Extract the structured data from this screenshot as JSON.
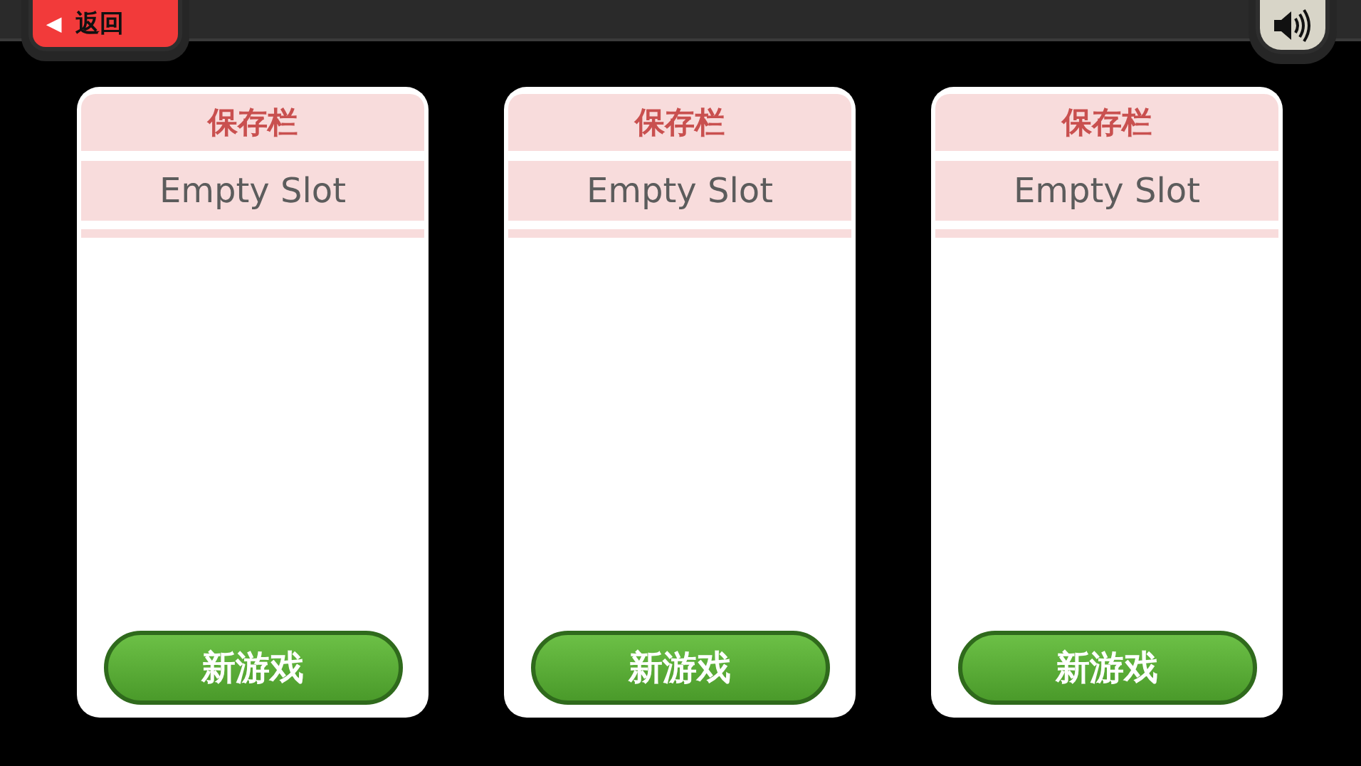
{
  "top_bar": {
    "back_button": {
      "arrow": "◀",
      "label": "返回"
    }
  },
  "save_slots": [
    {
      "title": "保存栏",
      "status": "Empty Slot",
      "button": "新游戏"
    },
    {
      "title": "保存栏",
      "status": "Empty Slot",
      "button": "新游戏"
    },
    {
      "title": "保存栏",
      "status": "Empty Slot",
      "button": "新游戏"
    }
  ]
}
